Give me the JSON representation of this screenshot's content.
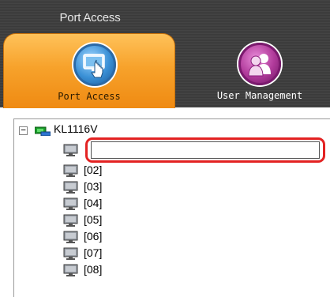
{
  "header": {
    "title": "Port Access"
  },
  "tabs": [
    {
      "label": "Port Access",
      "icon": "monitor-hand-icon",
      "active": true
    },
    {
      "label": "User Management",
      "icon": "users-icon",
      "active": false
    }
  ],
  "tree": {
    "root": {
      "expander": "−",
      "label": "KL1116V",
      "icon": "kvm-switch-icon"
    },
    "edit_value": "",
    "ports": [
      "[02]",
      "[03]",
      "[04]",
      "[05]",
      "[06]",
      "[07]",
      "[08]"
    ]
  },
  "colors": {
    "header_bg": "#3d3d3d",
    "active_tab": "#f7a22b",
    "highlight": "#e32222"
  }
}
